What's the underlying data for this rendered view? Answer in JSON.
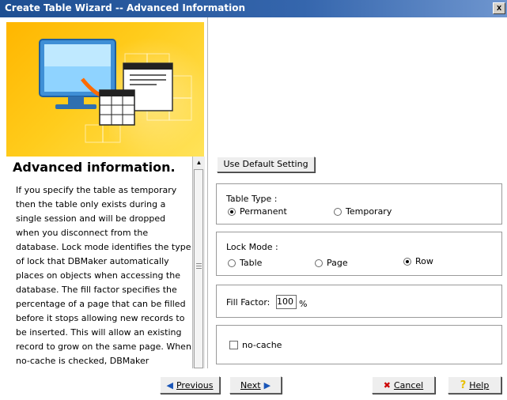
{
  "window": {
    "title": "Create Table Wizard -- Advanced Information",
    "close_label": "x"
  },
  "help": {
    "title": "Advanced information.",
    "body": "If you specify the table as temporary then the table only exists during a single session and will be dropped when you disconnect from the database. Lock mode identifies the type of lock that DBMaker automatically places on objects when accessing the database. The fill factor specifies the percentage of a page that can be filled before it stops allowing new records to be inserted. This will allow an existing record to grow on the same page. When no-cache is checked, DBMaker"
  },
  "buttons": {
    "use_default": "Use Default Setting",
    "previous": "Previous",
    "next": "Next",
    "cancel": "Cancel",
    "help": "Help"
  },
  "table_type": {
    "label": "Table Type :",
    "options": [
      "Permanent",
      "Temporary"
    ],
    "selected": "Permanent"
  },
  "lock_mode": {
    "label": "Lock Mode :",
    "options": [
      "Table",
      "Page",
      "Row"
    ],
    "selected": "Row"
  },
  "fill_factor": {
    "label": "Fill Factor:",
    "value": "100",
    "unit": "%"
  },
  "no_cache": {
    "label": "no-cache",
    "checked": false
  },
  "colors": {
    "titlebar": "#2a5aa0",
    "banner": "#ffcc1c",
    "cancel_icon": "#cc0000",
    "help_icon": "#e8c000",
    "nav_arrow": "#1a56b8"
  },
  "icons": {
    "previous": "arrow-left-icon",
    "next": "arrow-right-icon",
    "cancel": "red-x-icon",
    "help": "question-mark-icon"
  }
}
